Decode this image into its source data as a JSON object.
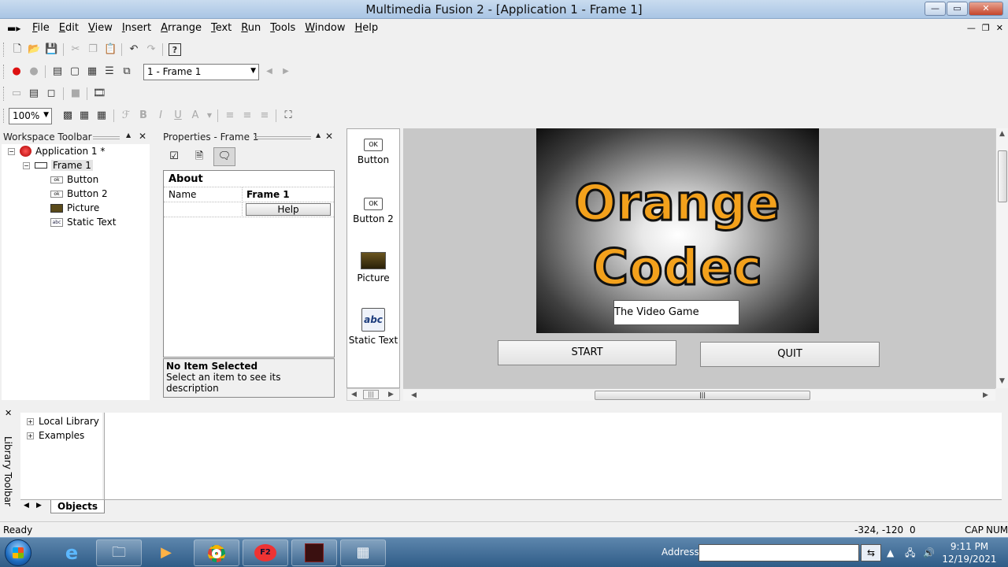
{
  "window": {
    "title": "Multimedia Fusion 2 - [Application 1 - Frame 1]",
    "minimize": "—",
    "maximize": "▭",
    "close": "✕"
  },
  "menubar": {
    "items": [
      {
        "label": "File",
        "u": "F",
        "rest": "ile"
      },
      {
        "label": "Edit",
        "u": "E",
        "rest": "dit"
      },
      {
        "label": "View",
        "u": "V",
        "rest": "iew"
      },
      {
        "label": "Insert",
        "u": "I",
        "rest": "nsert"
      },
      {
        "label": "Arrange",
        "u": "A",
        "rest": "rrange"
      },
      {
        "label": "Text",
        "u": "T",
        "rest": "ext"
      },
      {
        "label": "Run",
        "u": "R",
        "rest": "un"
      },
      {
        "label": "Tools",
        "u": "T",
        "rest": "ools"
      },
      {
        "label": "Window",
        "u": "W",
        "rest": "indow"
      },
      {
        "label": "Help",
        "u": "H",
        "rest": "elp"
      }
    ]
  },
  "toolbar": {
    "frame_select": "1 - Frame 1",
    "zoom": "100%"
  },
  "workspace": {
    "title": "Workspace Toolbar",
    "tree": [
      {
        "label": "Application 1 *",
        "icon": "application-icon"
      },
      {
        "label": "Frame 1",
        "icon": "frame-icon"
      },
      {
        "label": "Button",
        "icon": "button-object-icon"
      },
      {
        "label": "Button 2",
        "icon": "button-object-icon"
      },
      {
        "label": "Picture",
        "icon": "picture-object-icon"
      },
      {
        "label": "Static Text",
        "icon": "static-text-object-icon"
      }
    ]
  },
  "properties": {
    "title": "Properties - Frame 1",
    "category": "About",
    "name_label": "Name",
    "name_value": "Frame 1",
    "help_button": "Help",
    "desc_title": "No Item Selected",
    "desc_text": "Select an item to see its description"
  },
  "objects": [
    {
      "label": "Button",
      "icon_text": "OK"
    },
    {
      "label": "Button 2",
      "icon_text": "OK"
    },
    {
      "label": "Picture",
      "icon_text": ""
    },
    {
      "label": "Static Text",
      "icon_text": "abc"
    }
  ],
  "frame": {
    "logo_line1": "Orange",
    "logo_line2": "Codec",
    "static_text": "The Video Game",
    "start_button": "START",
    "quit_button": "QUIT"
  },
  "library": {
    "side_label": "Library Toolbar",
    "tree": [
      "Local Library",
      "Examples"
    ],
    "tab": "Objects"
  },
  "status": {
    "ready": "Ready",
    "coords": "-324, -120",
    "zero": "0",
    "cap": "CAP",
    "num": "NUM"
  },
  "taskbar": {
    "address_label": "Address",
    "address_value": "",
    "time": "9:11 PM",
    "date": "12/19/2021",
    "fusion_label": "F2"
  },
  "colors": {
    "logo_orange": "#f3a11c",
    "taskbar_blue": "#2f5c87"
  }
}
